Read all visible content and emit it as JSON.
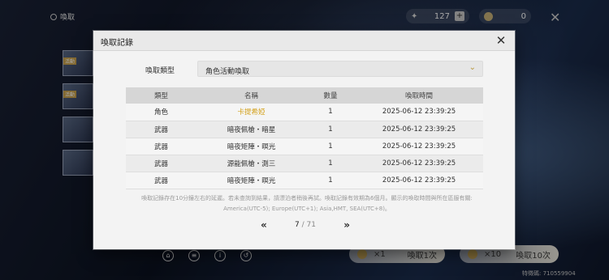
{
  "topbar": {
    "back_label": "喚取",
    "currency1": "127",
    "currency1_plus": "+",
    "currency2": "0",
    "close_symbol": "✕"
  },
  "left_cards": [
    {
      "tag": "活動"
    },
    {
      "tag": "活動"
    },
    {
      "tag": ""
    },
    {
      "tag": ""
    }
  ],
  "pull": {
    "one_count": "×1",
    "one_label": "喚取1次",
    "ten_count": "×10",
    "ten_label": "喚取10次"
  },
  "uid": "特徵碼: 710559904",
  "modal": {
    "title": "喚取記錄",
    "close_symbol": "✕",
    "filter_label": "喚取類型",
    "filter_value": "角色活動喚取",
    "columns": [
      "類型",
      "名稱",
      "數量",
      "喚取時間"
    ],
    "rows": [
      {
        "type": "角色",
        "name": "卡提希婭",
        "qty": "1",
        "time": "2025-06-12 23:39:25",
        "highlight": true
      },
      {
        "type": "武器",
        "name": "暗夜佩槍・暗星",
        "qty": "1",
        "time": "2025-06-12 23:39:25",
        "highlight": false
      },
      {
        "type": "武器",
        "name": "暗夜矩陣・暝光",
        "qty": "1",
        "time": "2025-06-12 23:39:25",
        "highlight": false
      },
      {
        "type": "武器",
        "name": "源能佩槍・測三",
        "qty": "1",
        "time": "2025-06-12 23:39:25",
        "highlight": false
      },
      {
        "type": "武器",
        "name": "暗夜矩陣・暝光",
        "qty": "1",
        "time": "2025-06-12 23:39:25",
        "highlight": false
      }
    ],
    "note_line1": "喚取記錄存在10分鐘左右的延遲。若未查詢到結果，請漂泊者稍後再試。喚取記錄有效期為6個月。顯示的喚取時間與所在區服有關:",
    "note_line2": "America(UTC-5); Europe(UTC+1); Asia,HMT, SEA(UTC+8)。",
    "pager": {
      "prev": "«",
      "current": "7",
      "total": " / 71",
      "next": "»"
    }
  },
  "colors": {
    "highlight": "#d4a11c",
    "modal_bg": "#f3f3f3",
    "header_row": "#d6d6d6"
  }
}
